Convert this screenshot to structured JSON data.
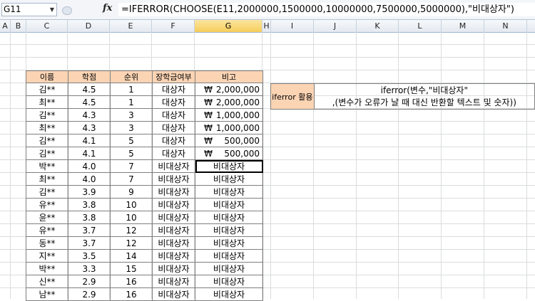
{
  "formula_bar": {
    "name_box": "G11",
    "fx_label": "fx",
    "formula": "=IFERROR(CHOOSE(E11,2000000,1500000,10000000,7500000,5000000),\"비대상자\")"
  },
  "columns": [
    "A",
    "B",
    "C",
    "D",
    "E",
    "F",
    "G",
    "H",
    "I",
    "J",
    "K",
    "L",
    "M",
    "N"
  ],
  "selected_column": "G",
  "table": {
    "headers": [
      "이름",
      "학점",
      "순위",
      "장학금여부",
      "비고"
    ],
    "rows": [
      {
        "name": "김**",
        "grade": "4.5",
        "rank": "1",
        "status": "대상자",
        "won": "₩",
        "amount": "2,000,000"
      },
      {
        "name": "최**",
        "grade": "4.5",
        "rank": "1",
        "status": "대상자",
        "won": "₩",
        "amount": "2,000,000"
      },
      {
        "name": "김**",
        "grade": "4.3",
        "rank": "3",
        "status": "대상자",
        "won": "₩",
        "amount": "1,000,000"
      },
      {
        "name": "최**",
        "grade": "4.3",
        "rank": "3",
        "status": "대상자",
        "won": "₩",
        "amount": "1,000,000"
      },
      {
        "name": "김**",
        "grade": "4.1",
        "rank": "5",
        "status": "대상자",
        "won": "₩",
        "amount": "500,000"
      },
      {
        "name": "김**",
        "grade": "4.1",
        "rank": "5",
        "status": "대상자",
        "won": "₩",
        "amount": "500,000"
      },
      {
        "name": "박**",
        "grade": "4.0",
        "rank": "7",
        "status": "비대상자",
        "note": "비대상자"
      },
      {
        "name": "최**",
        "grade": "4.0",
        "rank": "7",
        "status": "비대상자",
        "note": "비대상자"
      },
      {
        "name": "김**",
        "grade": "3.9",
        "rank": "9",
        "status": "비대상자",
        "note": "비대상자"
      },
      {
        "name": "유**",
        "grade": "3.8",
        "rank": "10",
        "status": "비대상자",
        "note": "비대상자"
      },
      {
        "name": "윤**",
        "grade": "3.8",
        "rank": "10",
        "status": "비대상자",
        "note": "비대상자"
      },
      {
        "name": "유**",
        "grade": "3.7",
        "rank": "12",
        "status": "비대상자",
        "note": "비대상자"
      },
      {
        "name": "동**",
        "grade": "3.7",
        "rank": "12",
        "status": "비대상자",
        "note": "비대상자"
      },
      {
        "name": "지**",
        "grade": "3.5",
        "rank": "14",
        "status": "비대상자",
        "note": "비대상자"
      },
      {
        "name": "박**",
        "grade": "3.3",
        "rank": "15",
        "status": "비대상자",
        "note": "비대상자"
      },
      {
        "name": "신**",
        "grade": "2.9",
        "rank": "16",
        "status": "비대상자",
        "note": "비대상자"
      },
      {
        "name": "남**",
        "grade": "2.9",
        "rank": "16",
        "status": "비대상자",
        "note": "비대상자"
      }
    ]
  },
  "help_box": {
    "label": "iferror 활용",
    "line1": "iferror(변수,\"비대상자\"",
    "line2": ",(변수가 오류가 날 때 대신 반환할 텍스트 및 숫자))"
  },
  "colors": {
    "header_fill": "#fbd4b4",
    "selected_col": "#f7cd5a"
  }
}
